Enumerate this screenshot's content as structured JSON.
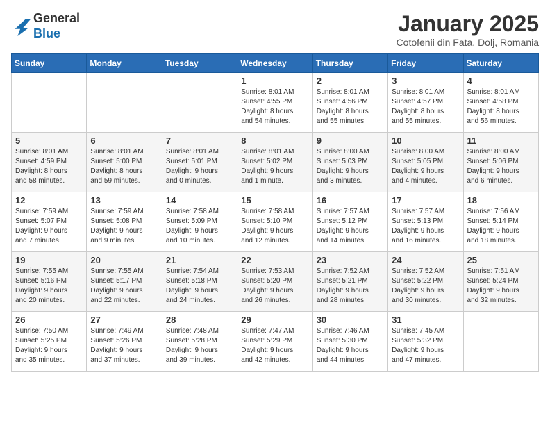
{
  "header": {
    "logo_general": "General",
    "logo_blue": "Blue",
    "month_title": "January 2025",
    "subtitle": "Cotofenii din Fata, Dolj, Romania"
  },
  "weekdays": [
    "Sunday",
    "Monday",
    "Tuesday",
    "Wednesday",
    "Thursday",
    "Friday",
    "Saturday"
  ],
  "weeks": [
    [
      {
        "day": "",
        "info": ""
      },
      {
        "day": "",
        "info": ""
      },
      {
        "day": "",
        "info": ""
      },
      {
        "day": "1",
        "info": "Sunrise: 8:01 AM\nSunset: 4:55 PM\nDaylight: 8 hours\nand 54 minutes."
      },
      {
        "day": "2",
        "info": "Sunrise: 8:01 AM\nSunset: 4:56 PM\nDaylight: 8 hours\nand 55 minutes."
      },
      {
        "day": "3",
        "info": "Sunrise: 8:01 AM\nSunset: 4:57 PM\nDaylight: 8 hours\nand 55 minutes."
      },
      {
        "day": "4",
        "info": "Sunrise: 8:01 AM\nSunset: 4:58 PM\nDaylight: 8 hours\nand 56 minutes."
      }
    ],
    [
      {
        "day": "5",
        "info": "Sunrise: 8:01 AM\nSunset: 4:59 PM\nDaylight: 8 hours\nand 58 minutes."
      },
      {
        "day": "6",
        "info": "Sunrise: 8:01 AM\nSunset: 5:00 PM\nDaylight: 8 hours\nand 59 minutes."
      },
      {
        "day": "7",
        "info": "Sunrise: 8:01 AM\nSunset: 5:01 PM\nDaylight: 9 hours\nand 0 minutes."
      },
      {
        "day": "8",
        "info": "Sunrise: 8:01 AM\nSunset: 5:02 PM\nDaylight: 9 hours\nand 1 minute."
      },
      {
        "day": "9",
        "info": "Sunrise: 8:00 AM\nSunset: 5:03 PM\nDaylight: 9 hours\nand 3 minutes."
      },
      {
        "day": "10",
        "info": "Sunrise: 8:00 AM\nSunset: 5:05 PM\nDaylight: 9 hours\nand 4 minutes."
      },
      {
        "day": "11",
        "info": "Sunrise: 8:00 AM\nSunset: 5:06 PM\nDaylight: 9 hours\nand 6 minutes."
      }
    ],
    [
      {
        "day": "12",
        "info": "Sunrise: 7:59 AM\nSunset: 5:07 PM\nDaylight: 9 hours\nand 7 minutes."
      },
      {
        "day": "13",
        "info": "Sunrise: 7:59 AM\nSunset: 5:08 PM\nDaylight: 9 hours\nand 9 minutes."
      },
      {
        "day": "14",
        "info": "Sunrise: 7:58 AM\nSunset: 5:09 PM\nDaylight: 9 hours\nand 10 minutes."
      },
      {
        "day": "15",
        "info": "Sunrise: 7:58 AM\nSunset: 5:10 PM\nDaylight: 9 hours\nand 12 minutes."
      },
      {
        "day": "16",
        "info": "Sunrise: 7:57 AM\nSunset: 5:12 PM\nDaylight: 9 hours\nand 14 minutes."
      },
      {
        "day": "17",
        "info": "Sunrise: 7:57 AM\nSunset: 5:13 PM\nDaylight: 9 hours\nand 16 minutes."
      },
      {
        "day": "18",
        "info": "Sunrise: 7:56 AM\nSunset: 5:14 PM\nDaylight: 9 hours\nand 18 minutes."
      }
    ],
    [
      {
        "day": "19",
        "info": "Sunrise: 7:55 AM\nSunset: 5:16 PM\nDaylight: 9 hours\nand 20 minutes."
      },
      {
        "day": "20",
        "info": "Sunrise: 7:55 AM\nSunset: 5:17 PM\nDaylight: 9 hours\nand 22 minutes."
      },
      {
        "day": "21",
        "info": "Sunrise: 7:54 AM\nSunset: 5:18 PM\nDaylight: 9 hours\nand 24 minutes."
      },
      {
        "day": "22",
        "info": "Sunrise: 7:53 AM\nSunset: 5:20 PM\nDaylight: 9 hours\nand 26 minutes."
      },
      {
        "day": "23",
        "info": "Sunrise: 7:52 AM\nSunset: 5:21 PM\nDaylight: 9 hours\nand 28 minutes."
      },
      {
        "day": "24",
        "info": "Sunrise: 7:52 AM\nSunset: 5:22 PM\nDaylight: 9 hours\nand 30 minutes."
      },
      {
        "day": "25",
        "info": "Sunrise: 7:51 AM\nSunset: 5:24 PM\nDaylight: 9 hours\nand 32 minutes."
      }
    ],
    [
      {
        "day": "26",
        "info": "Sunrise: 7:50 AM\nSunset: 5:25 PM\nDaylight: 9 hours\nand 35 minutes."
      },
      {
        "day": "27",
        "info": "Sunrise: 7:49 AM\nSunset: 5:26 PM\nDaylight: 9 hours\nand 37 minutes."
      },
      {
        "day": "28",
        "info": "Sunrise: 7:48 AM\nSunset: 5:28 PM\nDaylight: 9 hours\nand 39 minutes."
      },
      {
        "day": "29",
        "info": "Sunrise: 7:47 AM\nSunset: 5:29 PM\nDaylight: 9 hours\nand 42 minutes."
      },
      {
        "day": "30",
        "info": "Sunrise: 7:46 AM\nSunset: 5:30 PM\nDaylight: 9 hours\nand 44 minutes."
      },
      {
        "day": "31",
        "info": "Sunrise: 7:45 AM\nSunset: 5:32 PM\nDaylight: 9 hours\nand 47 minutes."
      },
      {
        "day": "",
        "info": ""
      }
    ]
  ]
}
